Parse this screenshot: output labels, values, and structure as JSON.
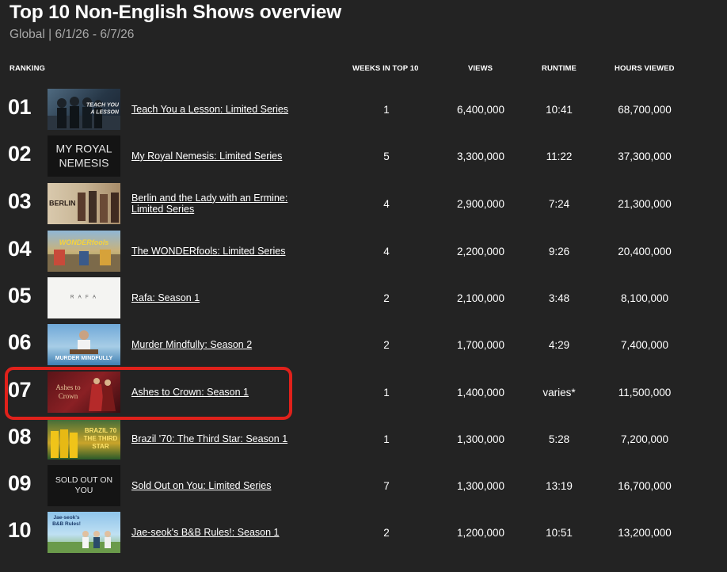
{
  "header": {
    "title": "Top 10 Non-English Shows overview",
    "subtitle": "Global | 6/1/26 - 6/7/26"
  },
  "columns": {
    "ranking": "RANKING",
    "weeks": "WEEKS IN TOP 10",
    "views": "VIEWS",
    "runtime": "RUNTIME",
    "hours": "HOURS VIEWED"
  },
  "rows": [
    {
      "rank": "01",
      "title": "Teach You a Lesson: Limited Series",
      "weeks": "1",
      "views": "6,400,000",
      "runtime": "10:41",
      "hours": "68,700,000",
      "thumb_text": "TEACH YOU A LESSON"
    },
    {
      "rank": "02",
      "title": "My Royal Nemesis: Limited Series",
      "weeks": "5",
      "views": "3,300,000",
      "runtime": "11:22",
      "hours": "37,300,000",
      "thumb_text": "MY ROYAL NEMESIS"
    },
    {
      "rank": "03",
      "title": "Berlin and the Lady with an Ermine: Limited Series",
      "weeks": "4",
      "views": "2,900,000",
      "runtime": "7:24",
      "hours": "21,300,000",
      "thumb_text": "BERLIN"
    },
    {
      "rank": "04",
      "title": "The WONDERfools: Limited Series",
      "weeks": "4",
      "views": "2,200,000",
      "runtime": "9:26",
      "hours": "20,400,000",
      "thumb_text": "WONDERfools"
    },
    {
      "rank": "05",
      "title": "Rafa: Season 1",
      "weeks": "2",
      "views": "2,100,000",
      "runtime": "3:48",
      "hours": "8,100,000",
      "thumb_text": "R A F A"
    },
    {
      "rank": "06",
      "title": "Murder Mindfully: Season 2",
      "weeks": "2",
      "views": "1,700,000",
      "runtime": "4:29",
      "hours": "7,400,000",
      "thumb_text": "MURDER MINDFULLY"
    },
    {
      "rank": "07",
      "title": "Ashes to Crown: Season 1",
      "weeks": "1",
      "views": "1,400,000",
      "runtime": "varies*",
      "hours": "11,500,000",
      "thumb_text": "Ashes to Crown"
    },
    {
      "rank": "08",
      "title": "Brazil '70: The Third Star: Season 1",
      "weeks": "1",
      "views": "1,300,000",
      "runtime": "5:28",
      "hours": "7,200,000",
      "thumb_text": "BRAZIL 70 THE THIRD STAR"
    },
    {
      "rank": "09",
      "title": "Sold Out on You: Limited Series",
      "weeks": "7",
      "views": "1,300,000",
      "runtime": "13:19",
      "hours": "16,700,000",
      "thumb_text": "SOLD OUT ON YOU"
    },
    {
      "rank": "10",
      "title": "Jae-seok's B&B Rules!: Season 1",
      "weeks": "2",
      "views": "1,200,000",
      "runtime": "10:51",
      "hours": "13,200,000",
      "thumb_text": "Jae-seok's B&B Rules!"
    }
  ],
  "colors": {
    "background": "#232323",
    "highlight": "#e0211b"
  }
}
